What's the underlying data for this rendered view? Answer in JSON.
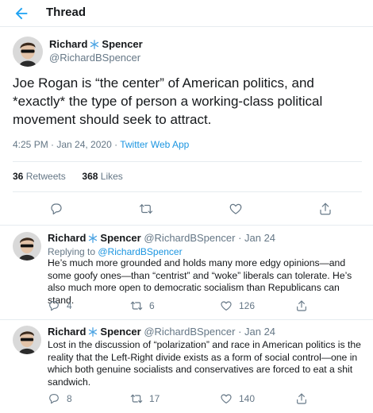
{
  "header": {
    "title": "Thread"
  },
  "main_tweet": {
    "name_first": "Richard",
    "name_last": "Spencer",
    "handle": "@RichardBSpencer",
    "text": "Joe Rogan is “the center” of American politics, and *exactly* the type of person a working-class political movement should seek to attract.",
    "time": "4:25 PM · Jan 24, 2020 · ",
    "app": "Twitter Web App",
    "retweets_count": "36",
    "retweets_label": "Retweets",
    "likes_count": "368",
    "likes_label": "Likes"
  },
  "replies": [
    {
      "name_first": "Richard",
      "name_last": "Spencer",
      "handle": "@RichardBSpencer",
      "date": "· Jan 24",
      "replying_prefix": "Replying to ",
      "replying_handle": "@RichardBSpencer",
      "text": "He’s much more grounded and holds many more edgy opinions—and some goofy ones—than “centrist” and “woke” liberals can tolerate. He’s also much more open to democratic socialism than Republicans can stand.",
      "reply_count": "4",
      "retweet_count": "6",
      "like_count": "126"
    },
    {
      "name_first": "Richard",
      "name_last": "Spencer",
      "handle": "@RichardBSpencer",
      "date": "· Jan 24",
      "text": "Lost in the discussion of “polarization” and race in American politics is the reality that the Left-Right divide exists as a form of social control—one in which both genuine socialists and conservatives are forced to eat a shit sandwich.",
      "reply_count": "8",
      "retweet_count": "17",
      "like_count": "140"
    }
  ],
  "colors": {
    "accent": "#1da1f2",
    "muted": "#657786",
    "text": "#14171a",
    "border": "#e6ecf0"
  }
}
